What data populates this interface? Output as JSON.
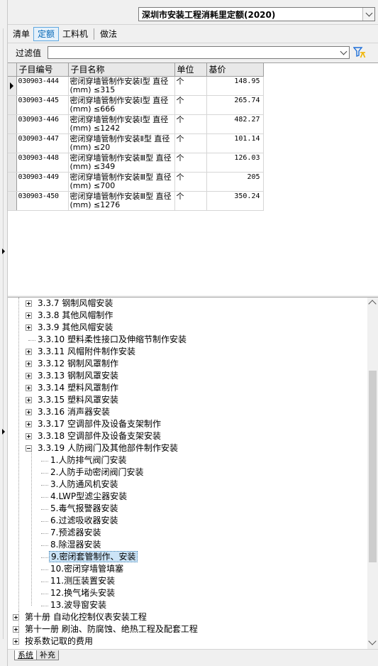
{
  "library": {
    "selected": "深圳市安装工程消耗里定额(2020)"
  },
  "tabs": [
    {
      "label": "清单",
      "active": false
    },
    {
      "label": "定额",
      "active": true
    },
    {
      "label": "工料机",
      "active": false
    },
    {
      "label": "做法",
      "active": false
    }
  ],
  "filter": {
    "label": "过滤值",
    "value": ""
  },
  "grid": {
    "columns": [
      "子目编号",
      "子目名称",
      "单位",
      "基价"
    ],
    "rows": [
      {
        "code": "030903-444",
        "name": "密闭穿墙管制作安装Ⅰ型 直径(mm) ≤315",
        "unit": "个",
        "price": "148.95"
      },
      {
        "code": "030903-445",
        "name": "密闭穿墙管制作安装Ⅰ型 直径(mm) ≤666",
        "unit": "个",
        "price": "265.74"
      },
      {
        "code": "030903-446",
        "name": "密闭穿墙管制作安装Ⅰ型 直径(mm) ≤1242",
        "unit": "个",
        "price": "482.27"
      },
      {
        "code": "030903-447",
        "name": "密闭穿墙管制作安装Ⅱ型 直径(mm) ≤20",
        "unit": "个",
        "price": "101.14"
      },
      {
        "code": "030903-448",
        "name": "密闭穿墙管制作安装Ⅲ型 直径(mm) ≤349",
        "unit": "个",
        "price": "126.03"
      },
      {
        "code": "030903-449",
        "name": "密闭穿墙管制作安装Ⅲ型 直径(mm) ≤700",
        "unit": "个",
        "price": "205"
      },
      {
        "code": "030903-450",
        "name": "密闭穿墙管制作安装Ⅲ型 直径(mm) ≤1276",
        "unit": "个",
        "price": "350.24"
      }
    ]
  },
  "tree": {
    "items": [
      {
        "label": "3.3.7 钢制风帽安装",
        "level": 2,
        "expander": "plus"
      },
      {
        "label": "3.3.8 其他风帽制作",
        "level": 2,
        "expander": "plus"
      },
      {
        "label": "3.3.9 其他风帽安装",
        "level": 2,
        "expander": "plus"
      },
      {
        "label": "3.3.10 塑料柔性接口及伸缩节制作安装",
        "level": 2,
        "expander": "none"
      },
      {
        "label": "3.3.11 风帽附件制作安装",
        "level": 2,
        "expander": "plus"
      },
      {
        "label": "3.3.12 钢制风罩制作",
        "level": 2,
        "expander": "plus"
      },
      {
        "label": "3.3.13 钢制风罩安装",
        "level": 2,
        "expander": "plus"
      },
      {
        "label": "3.3.14 塑料风罩制作",
        "level": 2,
        "expander": "plus"
      },
      {
        "label": "3.3.15 塑料风罩安装",
        "level": 2,
        "expander": "plus"
      },
      {
        "label": "3.3.16 消声器安装",
        "level": 2,
        "expander": "plus"
      },
      {
        "label": "3.3.17 空调部件及设备支架制作",
        "level": 2,
        "expander": "plus"
      },
      {
        "label": "3.3.18 空调部件及设备支架安装",
        "level": 2,
        "expander": "plus"
      },
      {
        "label": "3.3.19 人防阀门及其他部件制作安装",
        "level": 2,
        "expander": "minus"
      },
      {
        "label": "1.人防排气阀门安装",
        "level": 3,
        "expander": "none"
      },
      {
        "label": "2.人防手动密闭阀门安装",
        "level": 3,
        "expander": "none"
      },
      {
        "label": "3.人防通风机安装",
        "level": 3,
        "expander": "none"
      },
      {
        "label": "4.LWP型滤尘器安装",
        "level": 3,
        "expander": "none"
      },
      {
        "label": "5.毒气报警器安装",
        "level": 3,
        "expander": "none"
      },
      {
        "label": "6.过滤吸收器安装",
        "level": 3,
        "expander": "none"
      },
      {
        "label": "7.预滤器安装",
        "level": 3,
        "expander": "none"
      },
      {
        "label": "8.除湿器安装",
        "level": 3,
        "expander": "none"
      },
      {
        "label": "9.密闭套管制作、安装",
        "level": 3,
        "expander": "none",
        "selected": true
      },
      {
        "label": "10.密闭穿墙管填塞",
        "level": 3,
        "expander": "none"
      },
      {
        "label": "11.测压装置安装",
        "level": 3,
        "expander": "none"
      },
      {
        "label": "12.换气堵头安装",
        "level": 3,
        "expander": "none"
      },
      {
        "label": "13.波导窗安装",
        "level": 3,
        "expander": "none"
      },
      {
        "label": "第十册 自动化控制仪表安装工程",
        "level": 0,
        "expander": "plus"
      },
      {
        "label": "第十一册 刷油、防腐蚀、绝热工程及配套工程",
        "level": 0,
        "expander": "plus"
      },
      {
        "label": "按系数记取的费用",
        "level": 0,
        "expander": "plus"
      }
    ]
  },
  "tree_scroll": {
    "position_fraction": 0.45
  },
  "bottom_tabs": [
    {
      "label": "系统",
      "active": true
    },
    {
      "label": "补充",
      "active": false
    }
  ],
  "icons": {
    "filter_icon": "filter-funnel-icon",
    "row_indicator": "row-pointer-icon"
  },
  "colors": {
    "selection": "#cce4f7",
    "active_tab": "#0064b4",
    "filter_icon_blue": "#1e6fd8",
    "filter_icon_yellow": "#f0b400"
  }
}
